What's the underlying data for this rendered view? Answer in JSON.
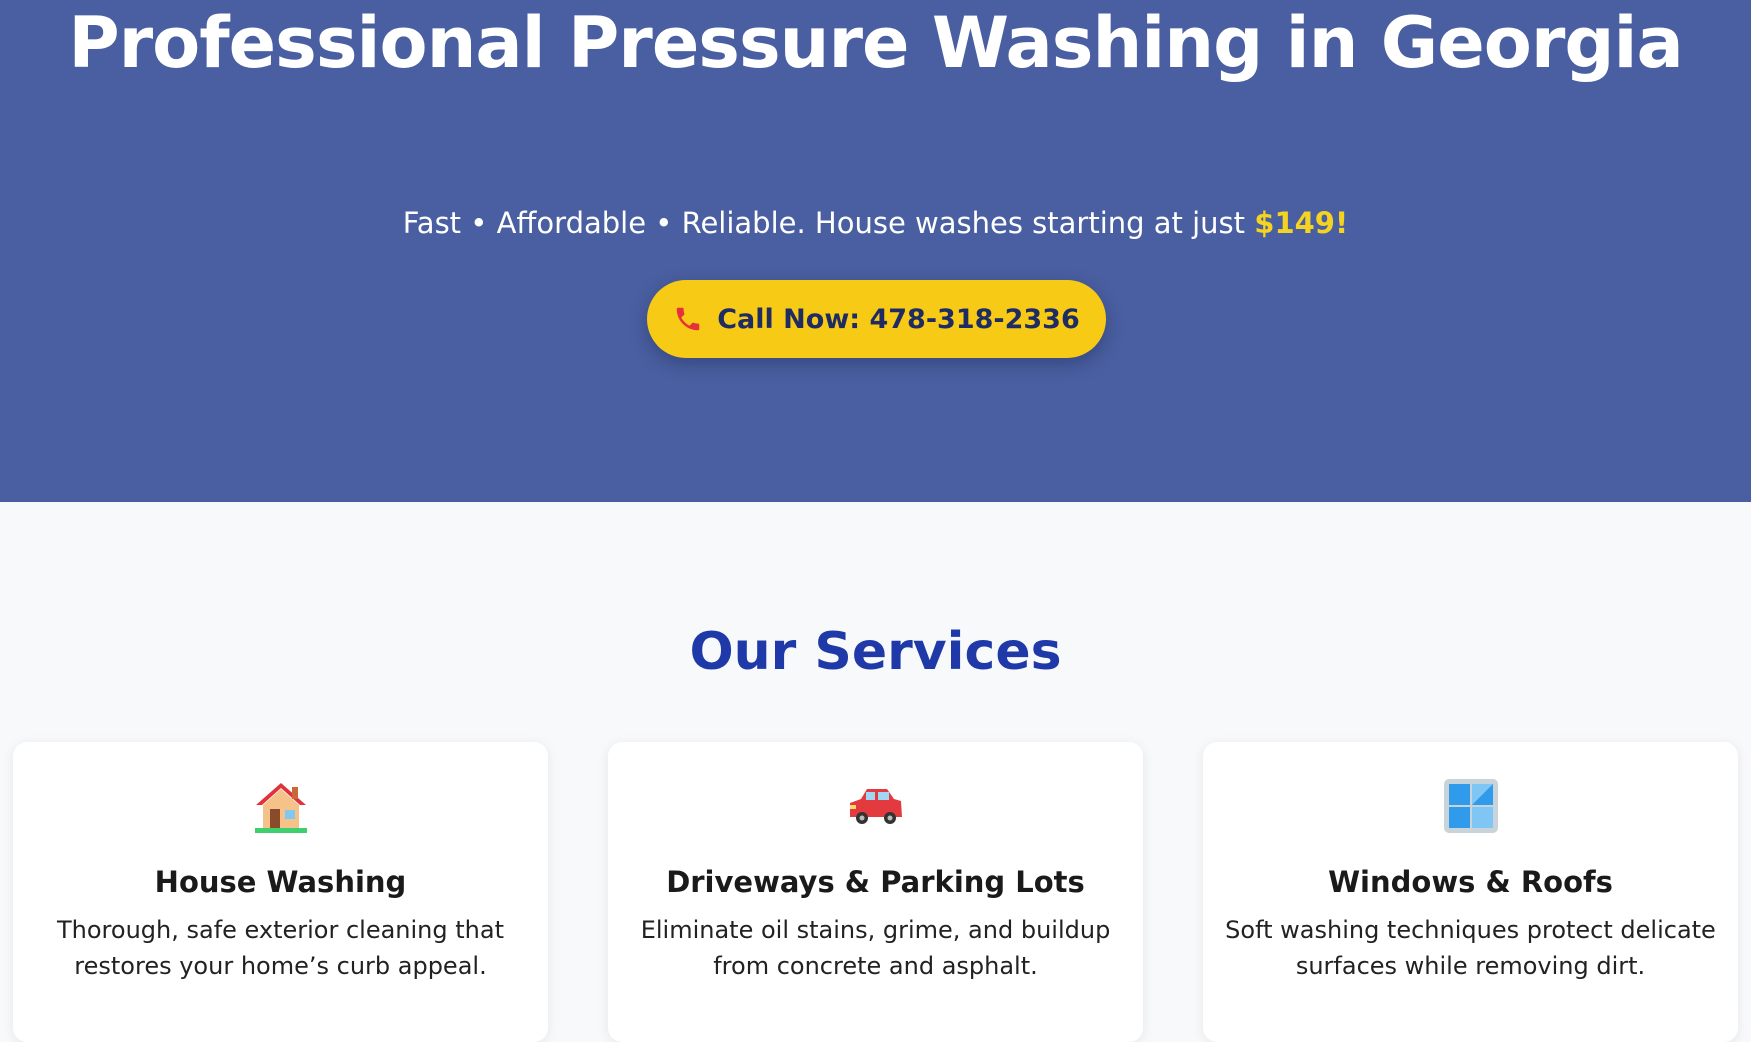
{
  "hero": {
    "title": "Professional Pressure Washing in Georgia",
    "subtitle_text": "Fast • Affordable • Reliable. House washes starting at just ",
    "subtitle_price": "$149!",
    "cta_label": "Call Now: 478-318-2336",
    "cta_icon": "phone-icon"
  },
  "services": {
    "heading": "Our Services",
    "items": [
      {
        "icon": "house-icon",
        "title": "House Washing",
        "description": "Thorough, safe exterior cleaning that restores your home’s curb appeal."
      },
      {
        "icon": "car-icon",
        "title": "Driveways & Parking Lots",
        "description": "Eliminate oil stains, grime, and buildup from concrete and asphalt."
      },
      {
        "icon": "window-icon",
        "title": "Windows & Roofs",
        "description": "Soft washing techniques protect delicate surfaces while removing dirt."
      }
    ]
  },
  "colors": {
    "hero_bg": "#4a5fa1",
    "cta_bg": "#f7cb15",
    "price": "#f5d321",
    "heading": "#1f3aa8",
    "page_bg": "#f8f9fb"
  }
}
